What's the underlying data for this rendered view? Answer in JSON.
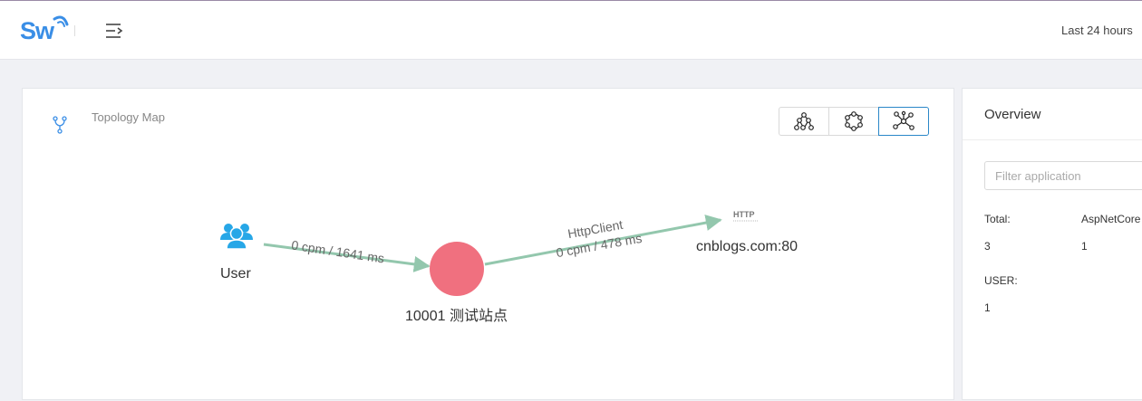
{
  "header": {
    "logo_text": "Sw",
    "time_range": "Last 24 hours"
  },
  "topology": {
    "title": "Topology Map",
    "layout_buttons": [
      "layout-hierarchy-icon",
      "layout-circle-icon",
      "layout-force-icon"
    ],
    "active_layout": 2,
    "nodes": [
      {
        "id": "user",
        "label": "User",
        "kind": "user"
      },
      {
        "id": "site",
        "label": "10001 测试站点",
        "kind": "service",
        "color": "#f0707f"
      },
      {
        "id": "cnblogs",
        "label": "cnblogs.com:80",
        "kind": "http"
      }
    ],
    "edges": [
      {
        "from": "user",
        "to": "site",
        "label": "0 cpm / 1641 ms"
      },
      {
        "from": "site",
        "to": "cnblogs",
        "label_top": "HttpClient",
        "label": "0 cpm / 478 ms"
      }
    ],
    "http_badge": "HTTP",
    "edge_color": "#93c7ad"
  },
  "overview": {
    "title": "Overview",
    "filter_placeholder": "Filter application",
    "stats": [
      {
        "label": "Total:",
        "value": "3"
      },
      {
        "label": "AspNetCore",
        "value": "1"
      },
      {
        "label": "USER:",
        "value": "1"
      }
    ]
  },
  "colors": {
    "accent": "#3a8ee6",
    "active_border": "#2a87c8",
    "user_icon": "#27a7e7"
  }
}
